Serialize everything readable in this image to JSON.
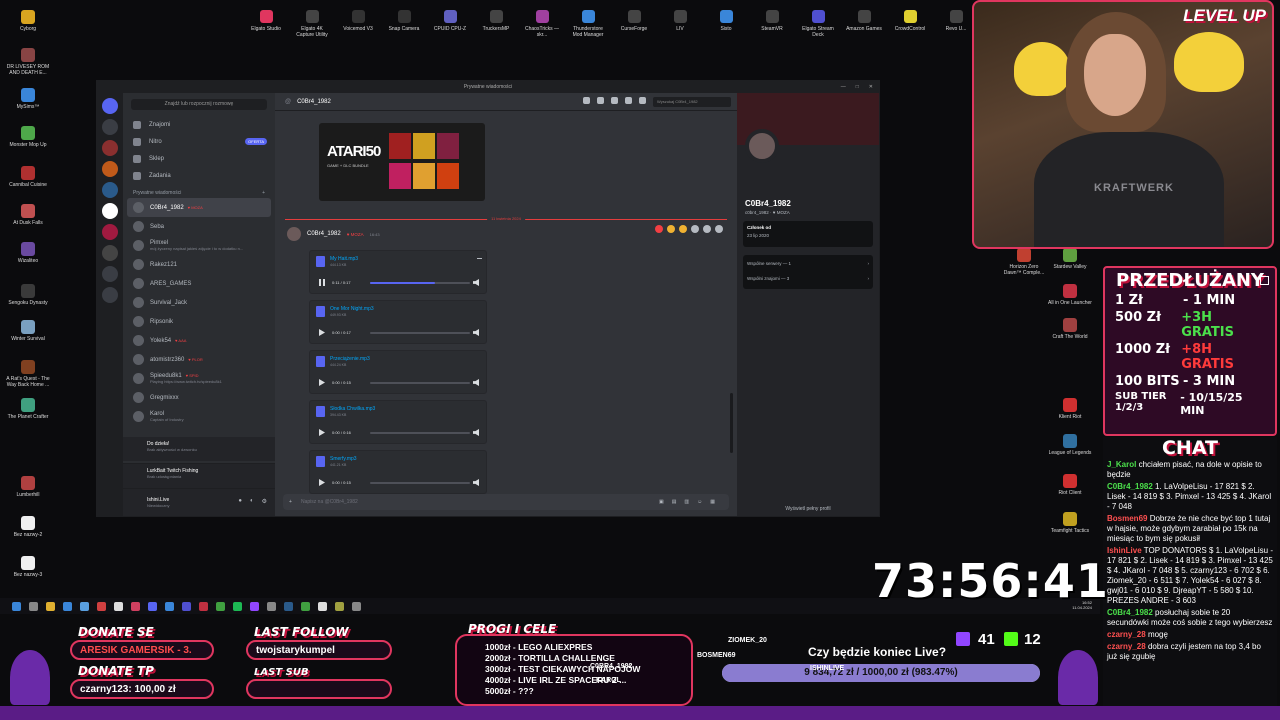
{
  "desktop": {
    "left_icons": [
      {
        "label": "Cyborg",
        "color": "#d9a520"
      },
      {
        "label": "DR LIVESEY ROM AND DEATH E...",
        "color": "#884444"
      },
      {
        "label": "MySims™",
        "color": "#3a86d9"
      },
      {
        "label": "Monster Mop Up",
        "color": "#4ea84a"
      },
      {
        "label": "Cannibal Cuisine",
        "color": "#b03030"
      },
      {
        "label": "At Dusk Falls",
        "color": "#c05050"
      },
      {
        "label": "Wizaliteo",
        "color": "#6a4aa0"
      },
      {
        "label": "Sengoku Dynasty",
        "color": "#3a3a3a"
      },
      {
        "label": "Winter Survival",
        "color": "#7aa0c0"
      },
      {
        "label": "A Rat's Quest - The Way Back Home ...",
        "color": "#804020"
      },
      {
        "label": "The Planet Crafter",
        "color": "#40a080"
      },
      {
        "label": "Lumberhill",
        "color": "#b04040"
      },
      {
        "label": "Bez nazwy-2",
        "color": "#f0f0f0"
      },
      {
        "label": "Bez nazwy-3",
        "color": "#f0f0f0"
      }
    ],
    "top_icons": [
      {
        "label": "Elgato Studio",
        "color": "#e0365f"
      },
      {
        "label": "Elgato 4K Capture Utility",
        "color": "#444"
      },
      {
        "label": "Voicemod V3",
        "color": "#333"
      },
      {
        "label": "Snap Camera",
        "color": "#333"
      },
      {
        "label": "CPUID CPU-Z",
        "color": "#6060c0"
      },
      {
        "label": "TruckersMP",
        "color": "#444"
      },
      {
        "label": "ChaosTricks — skr...",
        "color": "#a040a0"
      },
      {
        "label": "Thunderstore Mod Manager",
        "color": "#3a86d9"
      },
      {
        "label": "CurseForge",
        "color": "#444"
      },
      {
        "label": "LIV",
        "color": "#444"
      },
      {
        "label": "Sisto",
        "color": "#3a86d9"
      },
      {
        "label": "SteamVR",
        "color": "#444"
      },
      {
        "label": "Elgato Stream Deck",
        "color": "#5050d0"
      },
      {
        "label": "Amazon Games",
        "color": "#444"
      },
      {
        "label": "CrowdControl",
        "color": "#e0d030"
      },
      {
        "label": "Revo U...",
        "color": "#444"
      }
    ],
    "right_icons": [
      {
        "label": "Horizon Zero Dawn™ Comple...",
        "color": "#c04030"
      },
      {
        "label": "Stardew Valley",
        "color": "#60a040"
      },
      {
        "label": "All in One Launcher",
        "color": "#c03040"
      },
      {
        "label": "Craft The World",
        "color": "#a04040"
      },
      {
        "label": "Klient Riot",
        "color": "#d03030"
      },
      {
        "label": "League of Legends",
        "color": "#3070a0"
      },
      {
        "label": "Riot Client",
        "color": "#d03030"
      },
      {
        "label": "Teamfight Tactics",
        "color": "#c0a020"
      }
    ]
  },
  "discord": {
    "window_title": "Prywatne wiadomości",
    "search_placeholder": "Znajdź lub rozpocznij rozmowę",
    "nav": [
      {
        "label": "Znajomi"
      },
      {
        "label": "Nitro",
        "badge": "OFERTA"
      },
      {
        "label": "Sklep"
      },
      {
        "label": "Zadania"
      }
    ],
    "dm_header": "Prywatne wiadomości",
    "dms": [
      {
        "name": "C0Br4_1982",
        "tag": "♥ MOZA",
        "active": true
      },
      {
        "name": "Seba",
        "sub": ""
      },
      {
        "name": "Pimxel",
        "sub": "mój życzeny napisał jakieś zdjęcie i to w dodatku n..."
      },
      {
        "name": "Rakez121",
        "sub": ""
      },
      {
        "name": "ARES_GAMES",
        "sub": ""
      },
      {
        "name": "Survival_Jack",
        "sub": ""
      },
      {
        "name": "Ripsonik",
        "sub": ""
      },
      {
        "name": "Yolek54",
        "tag": "♥ AAA"
      },
      {
        "name": "atomistrz360",
        "tag": "♥ PLOR"
      },
      {
        "name": "Spieedu8k1",
        "tag": "♥ SPID",
        "sub": "Playing https://www.twitch.tv/spieedu8k1"
      },
      {
        "name": "Gregmixxx",
        "sub": ""
      },
      {
        "name": "Karol",
        "sub": "Captain of Industry"
      }
    ],
    "voice": {
      "title": "Do dzieła!",
      "sub": "Brak aktywności w dzwonku"
    },
    "activity": {
      "title": "LurkBait Twitch Fishing",
      "sub": "Brak udostępniania"
    },
    "user": {
      "name": "Ishini.Live",
      "status": "Niewidoczny"
    },
    "chat": {
      "channel": "C0Br4_1982",
      "search_placeholder": "Wyszukaj C0Br4_1982",
      "embed_logo": "ATARI50",
      "embed_sub": "GAME + DLC BUNDLE",
      "date_separator": "11 kwietnia 2024",
      "msg_author": "C0Br4_1982",
      "msg_tag": "♥ MOZA",
      "msg_time": "16:43",
      "composer_placeholder": "Napisz na @C0Br4_1982",
      "audio": [
        {
          "name": "My Hait.mp3",
          "size": "444.13 KB",
          "time": "0:11 / 0:17",
          "progress": 0.65,
          "playing": true
        },
        {
          "name": "One Mor Night.mp3",
          "size": "449.93 KB",
          "time": "0:00 / 0:17",
          "progress": 0,
          "playing": false
        },
        {
          "name": "Przeciążenie.mp3",
          "size": "444.24 KB",
          "time": "0:00 / 0:15",
          "progress": 0,
          "playing": false
        },
        {
          "name": "Słodka Chwilka.mp3",
          "size": "394.43 KB",
          "time": "0:00 / 0:16",
          "progress": 0,
          "playing": false
        },
        {
          "name": "Smerfy.mp3",
          "size": "441.21 KB",
          "time": "0:00 / 0:15",
          "progress": 0,
          "playing": false
        }
      ]
    },
    "profile": {
      "name": "C0Br4_1982",
      "handle": "c0br4_1982 · ♥ MOZA",
      "member_since_label": "Członek od",
      "member_since": "23 lip 2020",
      "mutual_servers": "Wspólne serwery — 1",
      "mutual_friends": "Wspólni znajomi — 3",
      "full_profile": "Wyświetl pełny profil"
    }
  },
  "taskbar": {
    "clock": "16:52",
    "date": "11.04.2024"
  },
  "stream": {
    "brand": "LEVEL UP",
    "shirt_text": "KRAFTWERK",
    "pricing": {
      "title": "PRZEDŁUŻANY",
      "rows": [
        {
          "left": "1 Zł",
          "right": "- 1 MIN",
          "style": ""
        },
        {
          "left": "500 Zł",
          "right": "+3H GRATIS",
          "style": "green"
        },
        {
          "left": "1000 Zł",
          "right": "+8H GRATIS",
          "style": "red"
        },
        {
          "left": "100 BITS",
          "right": "- 3 MIN",
          "style": ""
        },
        {
          "left": "SUB TIER 1/2/3",
          "right": "- 10/15/25 MIN",
          "style": ""
        }
      ]
    },
    "chat_title": "CHAT",
    "chat_lines": [
      {
        "user": "J_Karol",
        "color": "#4be04b",
        "text": "chciałem pisać, na dole w opisie to będzie"
      },
      {
        "user": "C0Br4_1982",
        "color": "#4be04b",
        "text": "1. LaVolpeLisu - 17 821 $ 2. Lisek - 14 819 $ 3. Pimxel - 13 425 $ 4. JKarol - 7 048"
      },
      {
        "user": "Bosmen69",
        "color": "#ff5050",
        "text": "Dobrze że nie chce być top 1 tutaj w hajsie, może gdybym zarabiał po 15k na miesiąc to bym się pokusił"
      },
      {
        "user": "IshinLive",
        "color": "#ff5050",
        "text": "TOP DONATORS $ 1. LaVolpeLisu - 17 821 $ 2. Lisek - 14 819 $ 3. Pimxel - 13 425 $ 4. JKarol - 7 048 $ 5. czarny123 - 6 702 $ 6. Ziomek_20 - 6 511 $ 7. Yolek54 - 6 027 $ 8. gwj01 - 6 010 $ 9. DjreapYT - 5 580 $ 10. PREZES ANDRE - 3 603"
      },
      {
        "user": "C0Br4_1982",
        "color": "#4be04b",
        "text": "posłuchaj sobie te 20 secundówki może coś sobie z tego wybierzesz"
      },
      {
        "user": "czarny_28",
        "color": "#ff5050",
        "text": "mogę"
      },
      {
        "user": "czarny_28",
        "color": "#ff5050",
        "text": "dobra czyli jestem na top 3,4 bo już się zgubię"
      }
    ],
    "donate_se_label": "DONATE SE",
    "donate_se_value": "ARESIK GAMERSIK - 3.",
    "donate_tp_label": "DONATE TP",
    "donate_tp_value": "czarny123: 100,00 zł",
    "last_follow_label": "LAST FOLLOW",
    "last_follow_value": "twojstarykumpel",
    "last_sub_label": "LAST SUB",
    "goals_label": "PROGI I CELE",
    "goals": [
      "1000zł - LEGO ALIEXPRES",
      "2000zł - TORTILLA CHALLENGE",
      "3000zł - TEST CIEKAWYCH NAPOJÓW",
      "4000zł - LIVE IRL ZE SPACERU Z ...",
      "5000zł - ???"
    ],
    "timer": "73:56:41",
    "question": "Czy będzie koniec Live?",
    "donation_progress": "9 834,72 zł / 1000,00 zł (983.47%)",
    "donation_fraction": 1.0,
    "viewers": "41",
    "subs": "12",
    "sprite_names": [
      "ZIOMEK_20",
      "BOSMEN69",
      "C0BR4_1982",
      "KAROL",
      "ISHINLIVE"
    ]
  }
}
